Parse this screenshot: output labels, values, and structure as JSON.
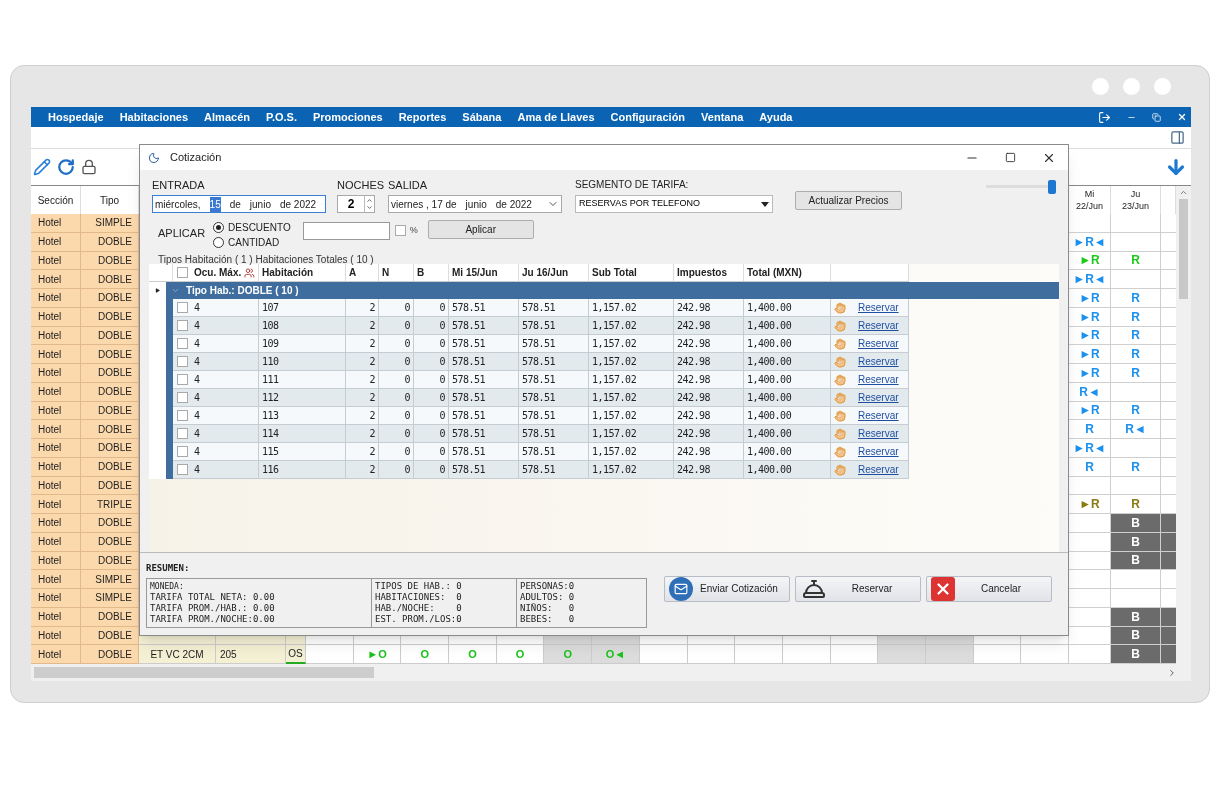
{
  "menu": [
    {
      "label": "Hospedaje"
    },
    {
      "label": "Habitaciones"
    },
    {
      "label": "Almacén"
    },
    {
      "label": "P.O.S."
    },
    {
      "label": "Promociones"
    },
    {
      "label": "Reportes"
    },
    {
      "label": "Sábana"
    },
    {
      "label": "Ama de Llaves"
    },
    {
      "label": "Configuración"
    },
    {
      "label": "Ventana"
    },
    {
      "label": "Ayuda"
    }
  ],
  "grid": {
    "columns": [
      "Sección",
      "Tipo"
    ],
    "days": [
      {
        "day": "Mi",
        "date": "22/Jun"
      },
      {
        "day": "Ju",
        "date": "23/Jun"
      }
    ],
    "rows": [
      {
        "section": "Hotel",
        "type": "SIMPLE",
        "days": [
          {
            "kind": "empty"
          },
          {
            "kind": "empty"
          }
        ]
      },
      {
        "section": "Hotel",
        "type": "DOBLE",
        "days": [
          {
            "kind": "mark",
            "text": "►R◄",
            "color": "#1a90f0"
          },
          {
            "kind": "empty"
          }
        ]
      },
      {
        "section": "Hotel",
        "type": "DOBLE",
        "days": [
          {
            "kind": "mark",
            "text": "►R",
            "color": "#19cc19"
          },
          {
            "kind": "mark",
            "text": "R",
            "color": "#19cc19"
          }
        ]
      },
      {
        "section": "Hotel",
        "type": "DOBLE",
        "days": [
          {
            "kind": "mark",
            "text": "►R◄",
            "color": "#1a90f0"
          },
          {
            "kind": "empty"
          }
        ]
      },
      {
        "section": "Hotel",
        "type": "DOBLE",
        "days": [
          {
            "kind": "mark",
            "text": "►R",
            "color": "#1a90f0"
          },
          {
            "kind": "mark",
            "text": "R",
            "color": "#1a90f0"
          }
        ]
      },
      {
        "section": "Hotel",
        "type": "DOBLE",
        "days": [
          {
            "kind": "mark",
            "text": "►R",
            "color": "#1a90f0"
          },
          {
            "kind": "mark",
            "text": "R",
            "color": "#1a90f0"
          }
        ]
      },
      {
        "section": "Hotel",
        "type": "DOBLE",
        "days": [
          {
            "kind": "mark",
            "text": "►R",
            "color": "#1a90f0"
          },
          {
            "kind": "mark",
            "text": "R",
            "color": "#1a90f0"
          }
        ]
      },
      {
        "section": "Hotel",
        "type": "DOBLE",
        "days": [
          {
            "kind": "mark",
            "text": "►R",
            "color": "#1a90f0"
          },
          {
            "kind": "mark",
            "text": "R",
            "color": "#1a90f0"
          }
        ]
      },
      {
        "section": "Hotel",
        "type": "DOBLE",
        "days": [
          {
            "kind": "mark",
            "text": "►R",
            "color": "#1a90f0"
          },
          {
            "kind": "mark",
            "text": "R",
            "color": "#1a90f0"
          }
        ]
      },
      {
        "section": "Hotel",
        "type": "DOBLE",
        "days": [
          {
            "kind": "mark",
            "text": "R◄",
            "color": "#1a90f0"
          },
          {
            "kind": "empty"
          }
        ]
      },
      {
        "section": "Hotel",
        "type": "DOBLE",
        "days": [
          {
            "kind": "mark",
            "text": "►R",
            "color": "#1a90f0"
          },
          {
            "kind": "mark",
            "text": "R",
            "color": "#1a90f0"
          }
        ]
      },
      {
        "section": "Hotel",
        "type": "DOBLE",
        "days": [
          {
            "kind": "mark",
            "text": "R",
            "color": "#1a90f0"
          },
          {
            "kind": "mark",
            "text": "R◄",
            "color": "#1a90f0"
          }
        ]
      },
      {
        "section": "Hotel",
        "type": "DOBLE",
        "days": [
          {
            "kind": "mark",
            "text": "►R◄",
            "color": "#1a90f0"
          },
          {
            "kind": "empty"
          }
        ]
      },
      {
        "section": "Hotel",
        "type": "DOBLE",
        "days": [
          {
            "kind": "mark",
            "text": "R",
            "color": "#1a90f0"
          },
          {
            "kind": "mark",
            "text": "R",
            "color": "#1a90f0"
          }
        ]
      },
      {
        "section": "Hotel",
        "type": "DOBLE",
        "days": [
          {
            "kind": "empty"
          },
          {
            "kind": "empty"
          }
        ]
      },
      {
        "section": "Hotel",
        "type": "TRIPLE",
        "days": [
          {
            "kind": "mark",
            "text": "►R",
            "color": "#8b7a12"
          },
          {
            "kind": "mark",
            "text": "R",
            "color": "#8b7a12"
          }
        ]
      },
      {
        "section": "Hotel",
        "type": "DOBLE",
        "days": [
          {
            "kind": "empty"
          },
          {
            "kind": "blocked",
            "text": "B"
          }
        ]
      },
      {
        "section": "Hotel",
        "type": "DOBLE",
        "days": [
          {
            "kind": "empty"
          },
          {
            "kind": "blocked",
            "text": "B"
          }
        ]
      },
      {
        "section": "Hotel",
        "type": "DOBLE",
        "days": [
          {
            "kind": "empty"
          },
          {
            "kind": "blocked",
            "text": "B"
          }
        ]
      },
      {
        "section": "Hotel",
        "type": "SIMPLE",
        "days": [
          {
            "kind": "empty"
          },
          {
            "kind": "empty"
          }
        ]
      },
      {
        "section": "Hotel",
        "type": "SIMPLE",
        "days": [
          {
            "kind": "empty"
          },
          {
            "kind": "empty"
          }
        ]
      },
      {
        "section": "Hotel",
        "type": "DOBLE",
        "days": [
          {
            "kind": "empty"
          },
          {
            "kind": "blocked",
            "text": "B"
          }
        ]
      },
      {
        "section": "Hotel",
        "type": "DOBLE",
        "days": [
          {
            "kind": "empty"
          },
          {
            "kind": "blocked",
            "text": "B"
          }
        ]
      },
      {
        "section": "Hotel",
        "type": "DOBLE",
        "days": [
          {
            "kind": "empty"
          },
          {
            "kind": "blocked",
            "text": "B"
          }
        ]
      }
    ],
    "room_row": {
      "room_type": "ET VC 2CM",
      "room": "205",
      "status": "OS",
      "cells": [
        {
          "kind": "empty",
          "shaded": false
        },
        {
          "kind": "mark",
          "text": "►O",
          "color": "#19c219",
          "shaded": false
        },
        {
          "kind": "mark",
          "text": "O",
          "color": "#19c219",
          "shaded": false
        },
        {
          "kind": "mark",
          "text": "O",
          "color": "#19c219",
          "shaded": false
        },
        {
          "kind": "mark",
          "text": "O",
          "color": "#19c219",
          "shaded": false
        },
        {
          "kind": "mark",
          "text": "O",
          "color": "#19c219",
          "shaded": true
        },
        {
          "kind": "mark",
          "text": "O◄",
          "color": "#19c219",
          "shaded": true
        },
        {
          "kind": "empty",
          "shaded": false
        },
        {
          "kind": "empty",
          "shaded": false
        },
        {
          "kind": "empty",
          "shaded": false
        },
        {
          "kind": "empty",
          "shaded": false
        },
        {
          "kind": "empty",
          "shaded": false
        },
        {
          "kind": "empty",
          "shaded": true
        },
        {
          "kind": "empty",
          "shaded": true
        },
        {
          "kind": "empty",
          "shaded": false
        },
        {
          "kind": "empty",
          "shaded": false
        }
      ]
    }
  },
  "dialog": {
    "title": "Cotización",
    "entrada": {
      "label": "ENTRADA",
      "parts": [
        {
          "text": "miércoles,",
          "selected": false
        },
        {
          "text": "15",
          "selected": true
        },
        {
          "text": "de",
          "selected": false
        },
        {
          "text": "junio",
          "selected": false
        },
        {
          "text": "de 2022",
          "selected": false
        }
      ]
    },
    "noches": {
      "label": "NOCHES",
      "value": "2"
    },
    "salida": {
      "label": "SALIDA",
      "parts": [
        {
          "text": "viernes , 17 de",
          "selected": false
        },
        {
          "text": "junio",
          "selected": false
        },
        {
          "text": "de 2022",
          "selected": false
        }
      ]
    },
    "segmento": {
      "label": "SEGMENTO DE TARIFA:",
      "value": "RESERVAS POR TELEFONO"
    },
    "update_button": "Actualizar Precios",
    "zoom_slider": {
      "level": 1
    },
    "aplicar": {
      "label": "APLICAR",
      "options": [
        {
          "label": "DESCUENTO",
          "selected": true
        },
        {
          "label": "CANTIDAD",
          "selected": false
        }
      ],
      "percent": {
        "label": "%",
        "checked": false
      },
      "button": "Aplicar"
    },
    "info": "Tipos Habitación ( 1 ) Habitaciones Totales ( 10 )",
    "table": {
      "select_all": {
        "checked": false
      },
      "columns": [
        "Ocu. Máx.",
        "Habitación",
        "A",
        "N",
        "B",
        "Mi 15/Jun",
        "Ju 16/Jun",
        "Sub Total",
        "Impuestos",
        "Total (MXN)"
      ],
      "group": {
        "label": "Tipo Hab.: DOBLE ( 10 )",
        "expanded": true
      },
      "rows": [
        {
          "checked": false,
          "cells": [
            "4",
            "107",
            "2",
            "0",
            "0",
            "578.51",
            "578.51",
            "1,157.02",
            "242.98",
            "1,400.00"
          ],
          "link": "Reservar"
        },
        {
          "checked": false,
          "cells": [
            "4",
            "108",
            "2",
            "0",
            "0",
            "578.51",
            "578.51",
            "1,157.02",
            "242.98",
            "1,400.00"
          ],
          "link": "Reservar"
        },
        {
          "checked": false,
          "cells": [
            "4",
            "109",
            "2",
            "0",
            "0",
            "578.51",
            "578.51",
            "1,157.02",
            "242.98",
            "1,400.00"
          ],
          "link": "Reservar"
        },
        {
          "checked": false,
          "cells": [
            "4",
            "110",
            "2",
            "0",
            "0",
            "578.51",
            "578.51",
            "1,157.02",
            "242.98",
            "1,400.00"
          ],
          "link": "Reservar"
        },
        {
          "checked": false,
          "cells": [
            "4",
            "111",
            "2",
            "0",
            "0",
            "578.51",
            "578.51",
            "1,157.02",
            "242.98",
            "1,400.00"
          ],
          "link": "Reservar"
        },
        {
          "checked": false,
          "cells": [
            "4",
            "112",
            "2",
            "0",
            "0",
            "578.51",
            "578.51",
            "1,157.02",
            "242.98",
            "1,400.00"
          ],
          "link": "Reservar"
        },
        {
          "checked": false,
          "cells": [
            "4",
            "113",
            "2",
            "0",
            "0",
            "578.51",
            "578.51",
            "1,157.02",
            "242.98",
            "1,400.00"
          ],
          "link": "Reservar"
        },
        {
          "checked": false,
          "cells": [
            "4",
            "114",
            "2",
            "0",
            "0",
            "578.51",
            "578.51",
            "1,157.02",
            "242.98",
            "1,400.00"
          ],
          "link": "Reservar"
        },
        {
          "checked": false,
          "cells": [
            "4",
            "115",
            "2",
            "0",
            "0",
            "578.51",
            "578.51",
            "1,157.02",
            "242.98",
            "1,400.00"
          ],
          "link": "Reservar"
        },
        {
          "checked": false,
          "cells": [
            "4",
            "116",
            "2",
            "0",
            "0",
            "578.51",
            "578.51",
            "1,157.02",
            "242.98",
            "1,400.00"
          ],
          "link": "Reservar"
        }
      ]
    },
    "summary": {
      "title": "RESUMEN:",
      "columns": [
        [
          "MONEDA:",
          "TARIFA TOTAL NETA: 0.00",
          "TARIFA PROM./HAB.: 0.00",
          "TARIFA PROM./NOCHE:0.00"
        ],
        [
          "TIPOS DE HAB.: 0",
          "HABITACIONES:  0",
          "HAB./NOCHE:    0",
          "EST. PROM./LOS:0"
        ],
        [
          "PERSONAS:0",
          "ADULTOS: 0",
          "NIÑOS:   0",
          "BEBES:   0"
        ]
      ]
    },
    "buttons": [
      {
        "kind": "send",
        "label": "Enviar Cotización"
      },
      {
        "kind": "book",
        "label": "Reservar"
      },
      {
        "kind": "cancel",
        "label": "Cancelar"
      }
    ]
  }
}
